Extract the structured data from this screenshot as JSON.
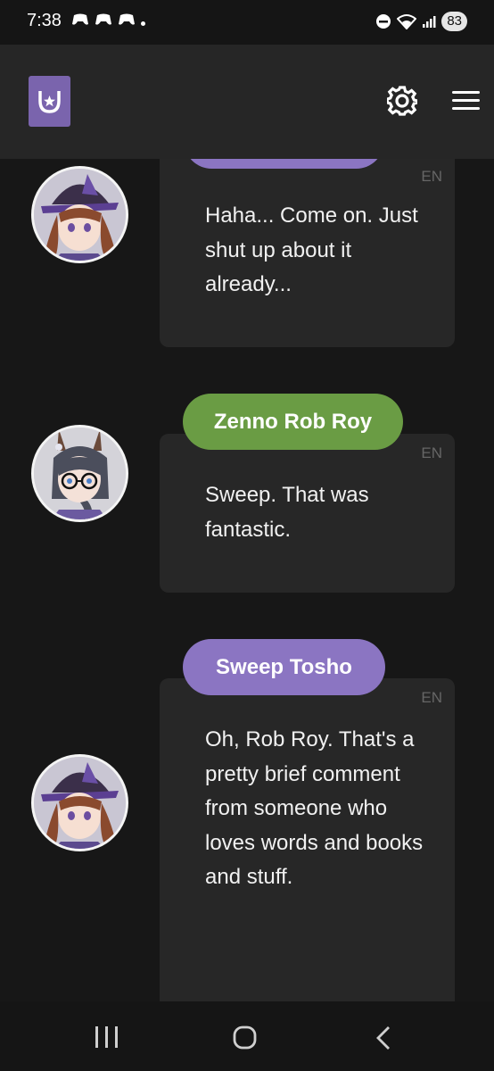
{
  "status_bar": {
    "time": "7:38",
    "battery": "83"
  },
  "header": {
    "logo_icon": "horseshoe-star-icon",
    "settings_icon": "gear-icon",
    "menu_icon": "hamburger-menu-icon"
  },
  "messages": [
    {
      "speaker": "",
      "speaker_color": "#8b75c2",
      "lang": "EN",
      "text": "Haha... Come on. Just shut up about it already..."
    },
    {
      "speaker": "Zenno Rob Roy",
      "speaker_color": "#6a9c44",
      "lang": "EN",
      "text": "Sweep. That was fantastic."
    },
    {
      "speaker": "Sweep Tosho",
      "speaker_color": "#8b75c2",
      "lang": "EN",
      "text": "Oh, Rob Roy. That's a pretty brief comment from someone who loves words and books and stuff."
    }
  ],
  "colors": {
    "background": "#171717",
    "header": "#262626",
    "bubble": "#272727",
    "accent_purple": "#7a64ad"
  }
}
